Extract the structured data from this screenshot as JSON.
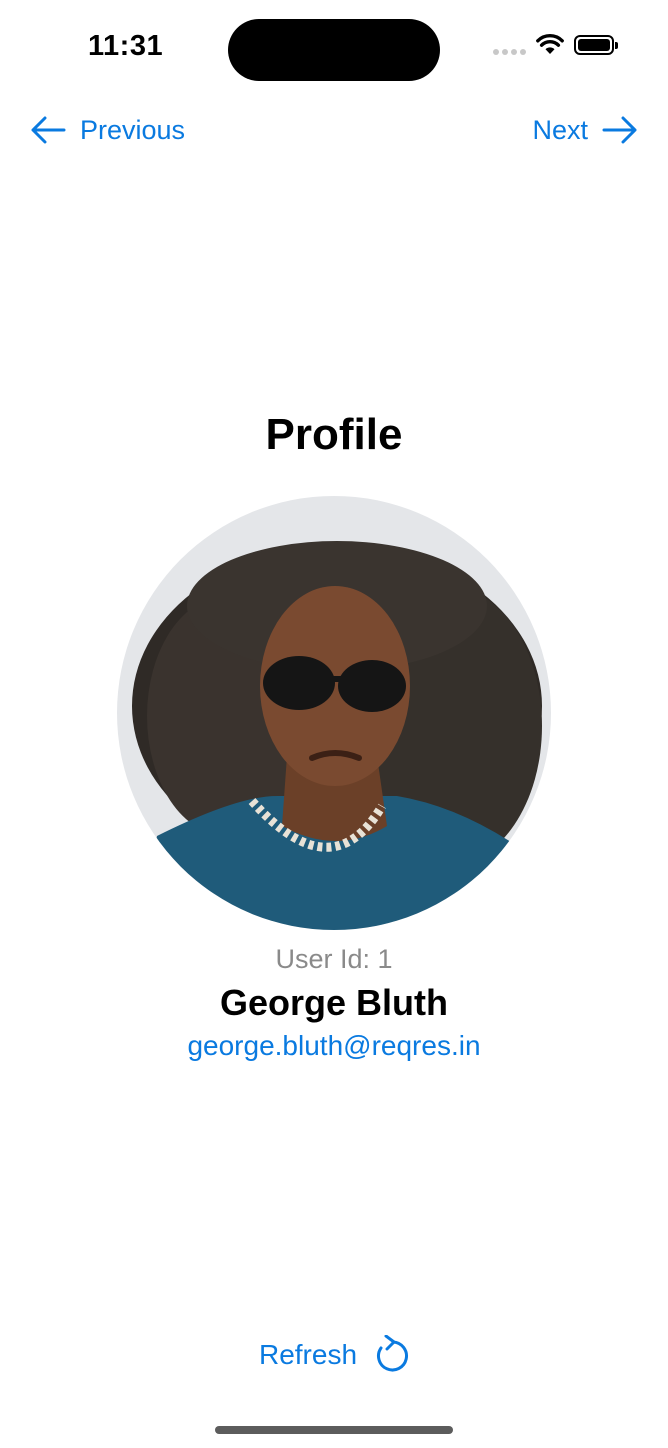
{
  "status_bar": {
    "time": "11:31",
    "icons": [
      "signal-dots-icon",
      "wifi-icon",
      "battery-icon"
    ]
  },
  "navigation": {
    "previous_label": "Previous",
    "next_label": "Next",
    "previous_icon": "arrow-left-icon",
    "next_icon": "arrow-right-icon"
  },
  "profile": {
    "title": "Profile",
    "user_id": "User Id: 1",
    "name": "George Bluth",
    "email": "george.bluth@reqres.in"
  },
  "actions": {
    "refresh_label": "Refresh",
    "refresh_icon": "refresh-icon"
  },
  "colors": {
    "accent": "#0a7ae0",
    "secondary_text": "#8a8a8a",
    "primary_text": "#000000",
    "background": "#ffffff"
  }
}
